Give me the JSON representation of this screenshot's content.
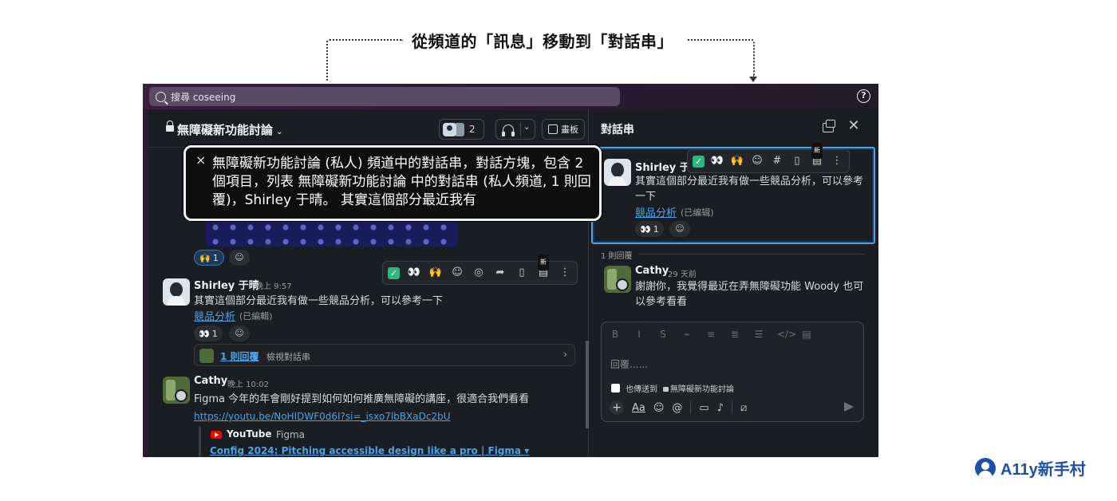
{
  "annotation": {
    "title": "從頻道的「訊息」移動到「對話串」",
    "brand": "A11y新手村"
  },
  "topbar": {
    "search_text": "搜尋 coseeing",
    "help": "?"
  },
  "channel": {
    "name": "無障礙新功能討論",
    "member_count": "2",
    "canvas_label": "畫板",
    "prev_reactions": [
      {
        "emoji": "🙌",
        "count": "1"
      }
    ],
    "toolbar": {
      "check": "✓",
      "eyes": "👀",
      "hands": "🙌",
      "add_reaction": "☺",
      "reply": "◎",
      "share": "➦",
      "bookmark": "▯",
      "more": "⋮",
      "new_badge": "新"
    },
    "messages": [
      {
        "author": "Shirley 于晴",
        "time": "晚上 9:57",
        "text": "其實這個部分最近我有做一些競品分析，可以參考一下",
        "link": "競品分析",
        "edited": "(已編輯)",
        "reaction": {
          "emoji": "👀",
          "count": "1"
        },
        "replies": {
          "count": "1 則回覆",
          "view": "檢視對話串"
        }
      },
      {
        "author": "Cathy",
        "time": "晚上 10:02",
        "text": "Figma 今年的年會剛好提到如何如何推廣無障礙的講座，很適合我們看看",
        "link": "https://youtu.be/NoHIDWF0d6I?si=_isxo7lbBXaDc2bU",
        "embed": {
          "provider": "YouTube",
          "sub": "Figma",
          "title": "Config 2024: Pitching accessible design like a pro | Figma"
        }
      }
    ]
  },
  "screen_reader": {
    "close": "×",
    "text": "無障礙新功能討論 (私人) 頻道中的對話串，對話方塊，包含 2 個項目，列表 無障礙新功能討論 中的對話串 (私人頻道, 1 則回覆)，Shirley 于晴。 其實這個部分最近我有"
  },
  "thread": {
    "title": "對話串",
    "parent": {
      "author": "Shirley 于晴",
      "text": "其實這個部分最近我有做一些競品分析，可以參考一下",
      "link": "競品分析",
      "edited": "(已编辑)",
      "reaction": {
        "emoji": "👀",
        "count": "1"
      }
    },
    "replies_label": "1 則回覆",
    "reply": {
      "author": "Cathy",
      "time": "29 天前",
      "text": "謝謝你，我覺得最近在弄無障礙功能 Woody 也可以參考看看"
    },
    "composer": {
      "placeholder": "回覆......",
      "also_send": "也傳送到",
      "channel": "無障礙新功能討論",
      "format_buttons": [
        "B",
        "I",
        "S",
        "⌁",
        "≡",
        "≣",
        "☰",
        "</>",
        "▤"
      ]
    }
  }
}
